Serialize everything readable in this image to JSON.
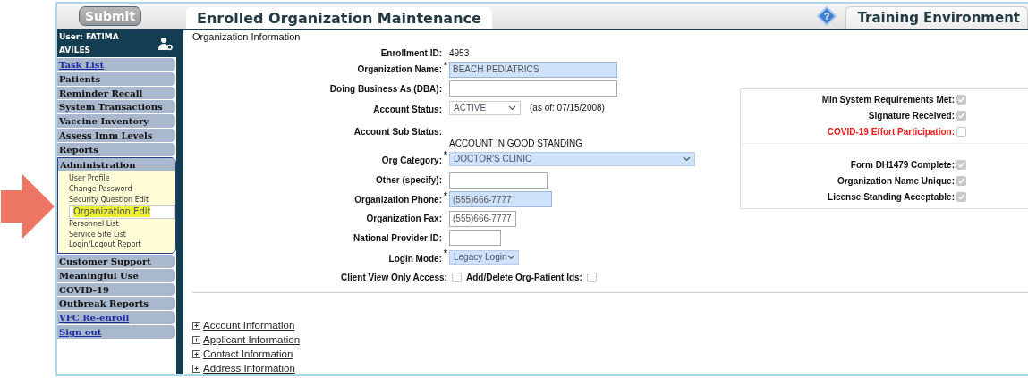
{
  "header": {
    "submit": "Submit",
    "tab": "Enrolled Organization Maintenance",
    "env_tab": "Training Environment",
    "help": "?"
  },
  "sidebar": {
    "user": "User: FATIMA AVILES",
    "items": [
      {
        "label": "Task List",
        "kind": "link"
      },
      {
        "label": "Patients",
        "kind": "menu"
      },
      {
        "label": "Reminder Recall",
        "kind": "menu"
      },
      {
        "label": "System Transactions",
        "kind": "menu"
      },
      {
        "label": "Vaccine Inventory",
        "kind": "menu"
      },
      {
        "label": "Assess Imm Levels",
        "kind": "menu"
      },
      {
        "label": "Reports",
        "kind": "menu"
      },
      {
        "label": "Administration",
        "kind": "menu",
        "expanded": true,
        "children": [
          {
            "label": "User Profile",
            "selected": false
          },
          {
            "label": "Change Password",
            "selected": false
          },
          {
            "label": "Security Question Edit",
            "selected": false
          },
          {
            "label": "Organization Edit",
            "selected": true
          },
          {
            "label": "Personnel List",
            "selected": false
          },
          {
            "label": "Service Site List",
            "selected": false
          },
          {
            "label": "Login/Logout Report",
            "selected": false
          }
        ]
      },
      {
        "label": "Customer Support",
        "kind": "menu"
      },
      {
        "label": "Meaningful Use",
        "kind": "menu"
      },
      {
        "label": "COVID-19",
        "kind": "menu"
      },
      {
        "label": "Outbreak Reports",
        "kind": "menu"
      },
      {
        "label": "VFC Re-enroll",
        "kind": "link"
      },
      {
        "label": "Sign out",
        "kind": "link"
      }
    ]
  },
  "section_title": "Organization Information",
  "fields": [
    {
      "label": "Enrollment ID:",
      "kind": "static",
      "value": "4953"
    },
    {
      "label": "Organization Name:",
      "kind": "text",
      "value": "BEACH PEDIATRICS",
      "required_mark": "*"
    },
    {
      "label": "Doing Business As (DBA):",
      "kind": "text"
    },
    {
      "label": "Account Status:",
      "kind": "select",
      "value": "ACTIVE",
      "note": "(as of: 07/15/2008)"
    },
    {
      "label": "Account Sub Status:",
      "kind": "substatus",
      "value": "ACCOUNT IN GOOD STANDING"
    },
    {
      "label": "Org Category:",
      "kind": "select",
      "value": "DOCTOR'S CLINIC",
      "required_mark": "*"
    },
    {
      "label": "Other (specify):",
      "kind": "text"
    },
    {
      "label": "Organization Phone:",
      "kind": "text",
      "value": "(555)666-7777",
      "required_mark": "*"
    },
    {
      "label": "Organization Fax:",
      "kind": "text",
      "value": "(555)666-7777"
    },
    {
      "label": "National Provider ID:",
      "kind": "text"
    },
    {
      "label": "Login Mode:",
      "kind": "select",
      "value": "Legacy Login",
      "required_mark": "*"
    }
  ],
  "access_checks": [
    {
      "label": "Client View Only Access:",
      "checked": false
    },
    {
      "label": "Add/Delete Org-Patient Ids:",
      "checked": false
    }
  ],
  "status_groups": [
    [
      {
        "label": "Min System Requirements Met:",
        "checked": true,
        "warning": false
      },
      {
        "label": "Signature Received:",
        "checked": true,
        "warning": false
      },
      {
        "label": "COVID-19 Effort Participation:",
        "checked": false,
        "warning": true
      }
    ],
    [
      {
        "label": "Form DH1479 Complete:",
        "checked": true,
        "warning": false
      },
      {
        "label": "Organization Name Unique:",
        "checked": true,
        "warning": false
      },
      {
        "label": "License Standing Acceptable:",
        "checked": true,
        "warning": false
      }
    ]
  ],
  "sections": [
    {
      "label": "Account Information"
    },
    {
      "label": "Applicant Information"
    },
    {
      "label": "Contact Information"
    },
    {
      "label": "Address Information"
    }
  ]
}
